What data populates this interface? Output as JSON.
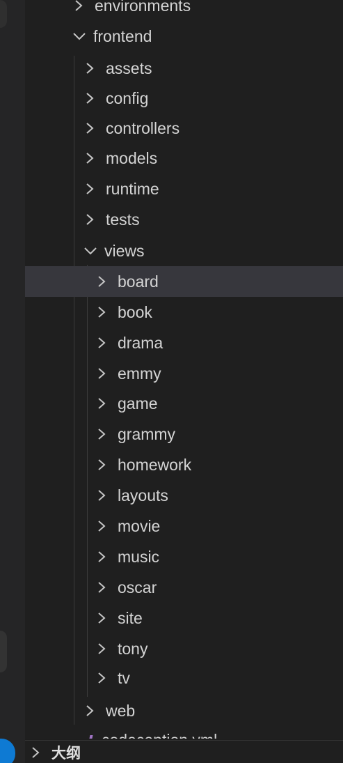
{
  "explorer": {
    "items": [
      {
        "label": "environments",
        "state": "collapsed"
      },
      {
        "label": "frontend",
        "state": "expanded"
      },
      {
        "label": "assets",
        "state": "collapsed"
      },
      {
        "label": "config",
        "state": "collapsed"
      },
      {
        "label": "controllers",
        "state": "collapsed"
      },
      {
        "label": "models",
        "state": "collapsed"
      },
      {
        "label": "runtime",
        "state": "collapsed"
      },
      {
        "label": "tests",
        "state": "collapsed"
      },
      {
        "label": "views",
        "state": "expanded"
      },
      {
        "label": "board",
        "state": "collapsed",
        "selected": true
      },
      {
        "label": "book",
        "state": "collapsed"
      },
      {
        "label": "drama",
        "state": "collapsed"
      },
      {
        "label": "emmy",
        "state": "collapsed"
      },
      {
        "label": "game",
        "state": "collapsed"
      },
      {
        "label": "grammy",
        "state": "collapsed"
      },
      {
        "label": "homework",
        "state": "collapsed"
      },
      {
        "label": "layouts",
        "state": "collapsed"
      },
      {
        "label": "movie",
        "state": "collapsed"
      },
      {
        "label": "music",
        "state": "collapsed"
      },
      {
        "label": "oscar",
        "state": "collapsed"
      },
      {
        "label": "site",
        "state": "collapsed"
      },
      {
        "label": "tony",
        "state": "collapsed"
      },
      {
        "label": "tv",
        "state": "collapsed"
      },
      {
        "label": "web",
        "state": "collapsed"
      },
      {
        "label": "codeception.yml",
        "state": "file"
      }
    ]
  },
  "outline": {
    "label": "大纲"
  },
  "icons": {
    "collapsed": "chevron-right-icon",
    "expanded": "chevron-down-icon",
    "file": "yml-file-icon"
  },
  "colors": {
    "selected_row": "#37373d",
    "accent": "#0e7ad3"
  }
}
